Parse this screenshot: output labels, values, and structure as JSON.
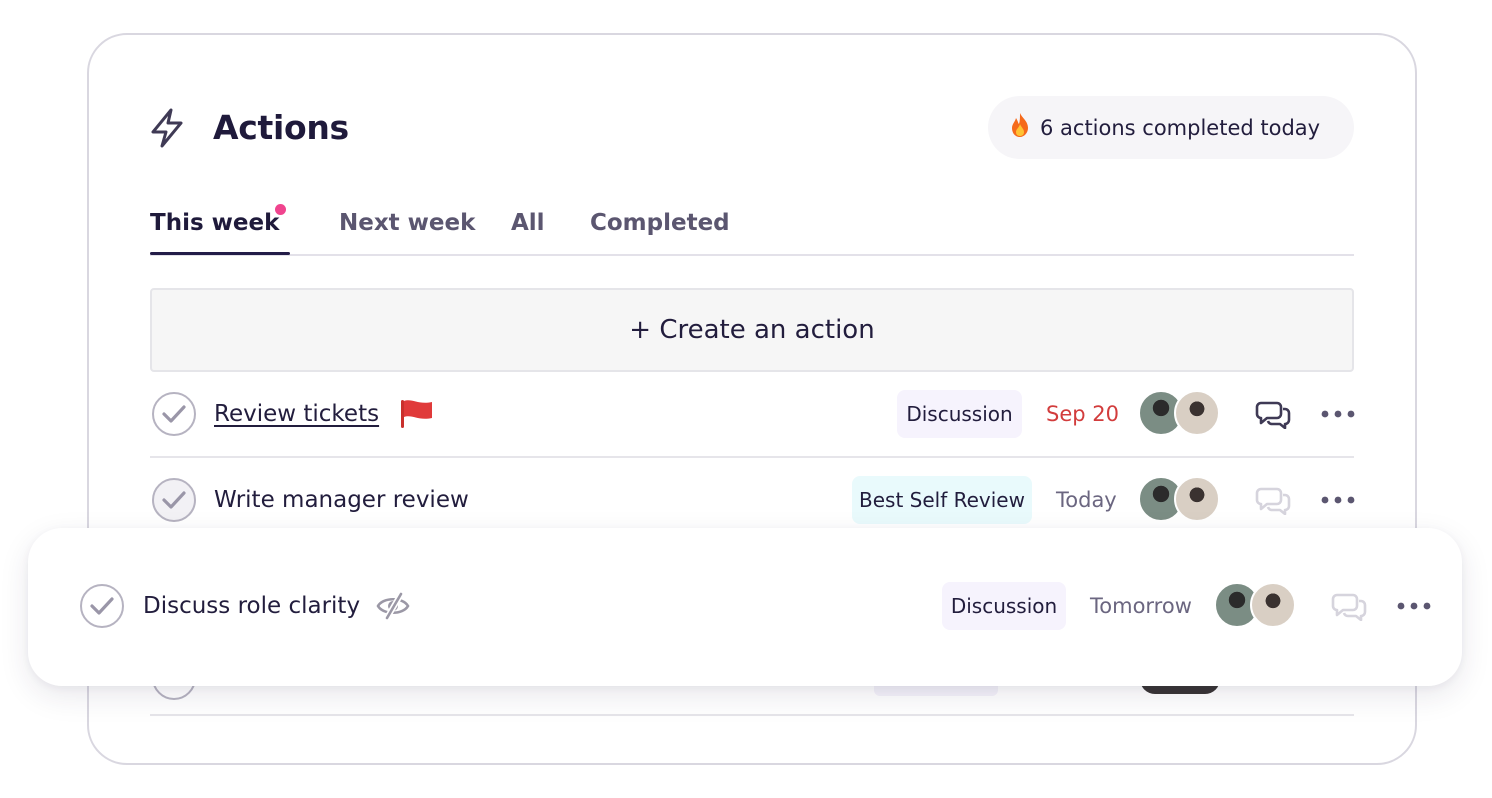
{
  "header": {
    "title": "Actions",
    "icon": "lightning-icon",
    "streak_text": "6 actions completed today",
    "streak_icon": "flame-icon"
  },
  "tabs": [
    {
      "label": "This week",
      "active": true,
      "has_notification": true
    },
    {
      "label": "Next week",
      "active": false
    },
    {
      "label": "All",
      "active": false
    },
    {
      "label": "Completed",
      "active": false
    }
  ],
  "create_button": {
    "label": "+ Create an action"
  },
  "actions": [
    {
      "title": "Review tickets",
      "linked": true,
      "marker_icon": "red-flag-icon",
      "tag": "Discussion",
      "tag_color": "#f6f3fd",
      "due": "Sep 20",
      "due_color": "#d23c3c",
      "comments_active": true
    },
    {
      "title": "Write manager review",
      "linked": false,
      "tag": "Best Self Review",
      "tag_color": "#e9fafc",
      "due": "Today",
      "due_color": "#6b6680",
      "comments_active": false
    },
    {
      "title": "Discuss role clarity",
      "linked": false,
      "marker_icon": "eye-slash-icon",
      "tag": "Discussion",
      "tag_color": "#f6f3fd",
      "due": "Tomorrow",
      "due_color": "#6b6680",
      "comments_active": false,
      "elevated": true
    }
  ],
  "colors": {
    "accent": "#231c48",
    "notification_dot": "#f0448e",
    "overdue": "#d23c3c",
    "border": "#d9d7e0"
  }
}
